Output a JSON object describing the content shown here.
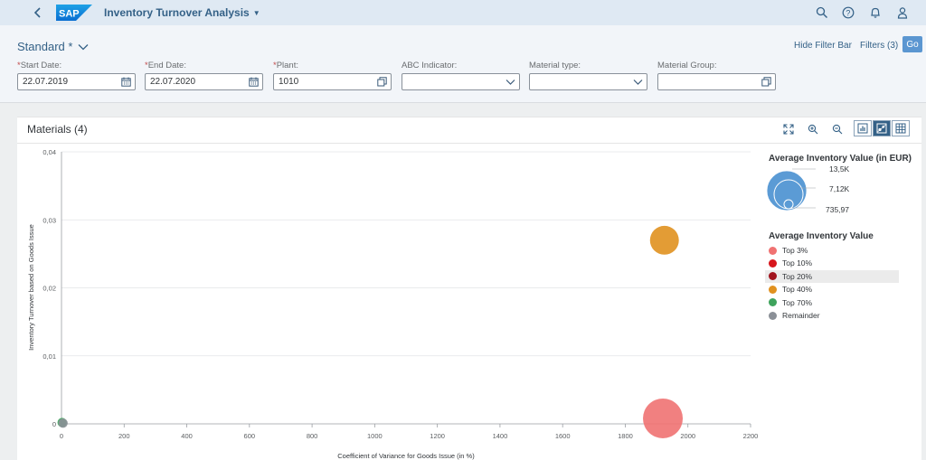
{
  "app": {
    "title": "Inventory Turnover Analysis"
  },
  "header": {
    "variant": "Standard *",
    "hide_filter_bar": "Hide Filter Bar",
    "filters_link": "Filters (3)",
    "go": "Go"
  },
  "filters": {
    "start_date": {
      "label": "Start Date:",
      "value": "22.07.2019",
      "required": "*"
    },
    "end_date": {
      "label": "End Date:",
      "value": "22.07.2020",
      "required": "*"
    },
    "plant": {
      "label": "Plant:",
      "value": "1010",
      "required": "*"
    },
    "abc_indicator": {
      "label": "ABC Indicator:",
      "value": ""
    },
    "material_type": {
      "label": "Material type:",
      "value": ""
    },
    "material_group": {
      "label": "Material Group:",
      "value": ""
    }
  },
  "panel": {
    "title": "Materials (4)"
  },
  "legend": {
    "size_title": "Average Inventory Value (in EUR)",
    "size_labels": [
      "13,5K",
      "7,12K",
      "735,97"
    ],
    "color_title": "Average Inventory Value",
    "items": [
      {
        "label": "Top 3%",
        "color": "#f07272"
      },
      {
        "label": "Top 10%",
        "color": "#d7161c"
      },
      {
        "label": "Top 20%",
        "color": "#a1141e"
      },
      {
        "label": "Top 40%",
        "color": "#e0911f"
      },
      {
        "label": "Top 70%",
        "color": "#3ea35c"
      },
      {
        "label": "Remainder",
        "color": "#8b9097"
      }
    ]
  },
  "chart_data": {
    "type": "scatter",
    "xlabel": "Coefficient of Variance for Goods Issue (in %)",
    "ylabel": "Inventory Turnover based on Goods Issue",
    "xlim": [
      0,
      2200
    ],
    "ylim": [
      0,
      0.04
    ],
    "x_ticks": [
      "0",
      "200",
      "400",
      "600",
      "800",
      "1000",
      "1200",
      "1400",
      "1600",
      "1800",
      "2000",
      "2200"
    ],
    "y_ticks": [
      "0",
      "0,01",
      "0,02",
      "0,03",
      "0,04"
    ],
    "points": [
      {
        "x": 1925,
        "y": 0.027,
        "size": 7120,
        "category": "Top 40%",
        "color": "#e0911f"
      },
      {
        "x": 1920,
        "y": 0.0008,
        "size": 13500,
        "category": "Top 3%",
        "color": "#f07272"
      },
      {
        "x": 2,
        "y": 0.0002,
        "size": 740,
        "category": "Top 70%",
        "color": "#3ea35c"
      },
      {
        "x": 5,
        "y": 0.0001,
        "size": 736,
        "category": "Remainder",
        "color": "#8b9097"
      }
    ],
    "grid": "horizontal",
    "legend_placement": "right"
  }
}
